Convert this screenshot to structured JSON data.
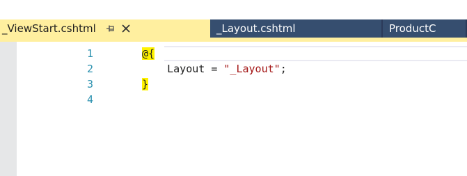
{
  "tabs": [
    {
      "label": "_ViewStart.cshtml",
      "active": true,
      "pin_icon": "pin-icon",
      "close_icon": "close-icon"
    },
    {
      "label": "_Layout.cshtml",
      "active": false
    },
    {
      "label": "ProductC",
      "active": false
    }
  ],
  "editor": {
    "line_numbers": [
      "1",
      "2",
      "3",
      "4"
    ],
    "lines": [
      {
        "open": "@{"
      },
      {
        "indent": "    ",
        "text": "Layout = ",
        "string": "\"_Layout\"",
        "end": ";"
      },
      {
        "close": "}"
      },
      {}
    ]
  },
  "colors": {
    "active_tab": "#ffef9f",
    "inactive_tab": "#364e6f",
    "tab_bar": "#2b3a5a",
    "line_number": "#2b91af",
    "brace_highlight": "#fff200",
    "string": "#a31515"
  }
}
